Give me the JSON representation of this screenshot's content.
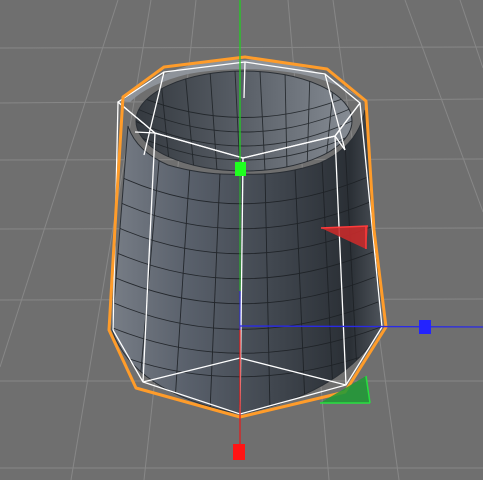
{
  "viewport": {
    "background_color": "#6f6f6f",
    "grid_color": "#8a8a8a"
  },
  "object": {
    "type": "tapered-cylinder",
    "selected": true,
    "selection_outline_color": "#ff9c2a",
    "cage_color": "#ffffff",
    "surface_color": "#4a4f57"
  },
  "axes": {
    "x_color": "#e01e1e",
    "y_color": "#22cc22",
    "z_color": "#2a2ae6"
  },
  "icons": {
    "x_handle": "square-handle",
    "y_handle": "square-handle",
    "z_handle": "square-handle",
    "rotation_gizmo": "angle-marker"
  }
}
